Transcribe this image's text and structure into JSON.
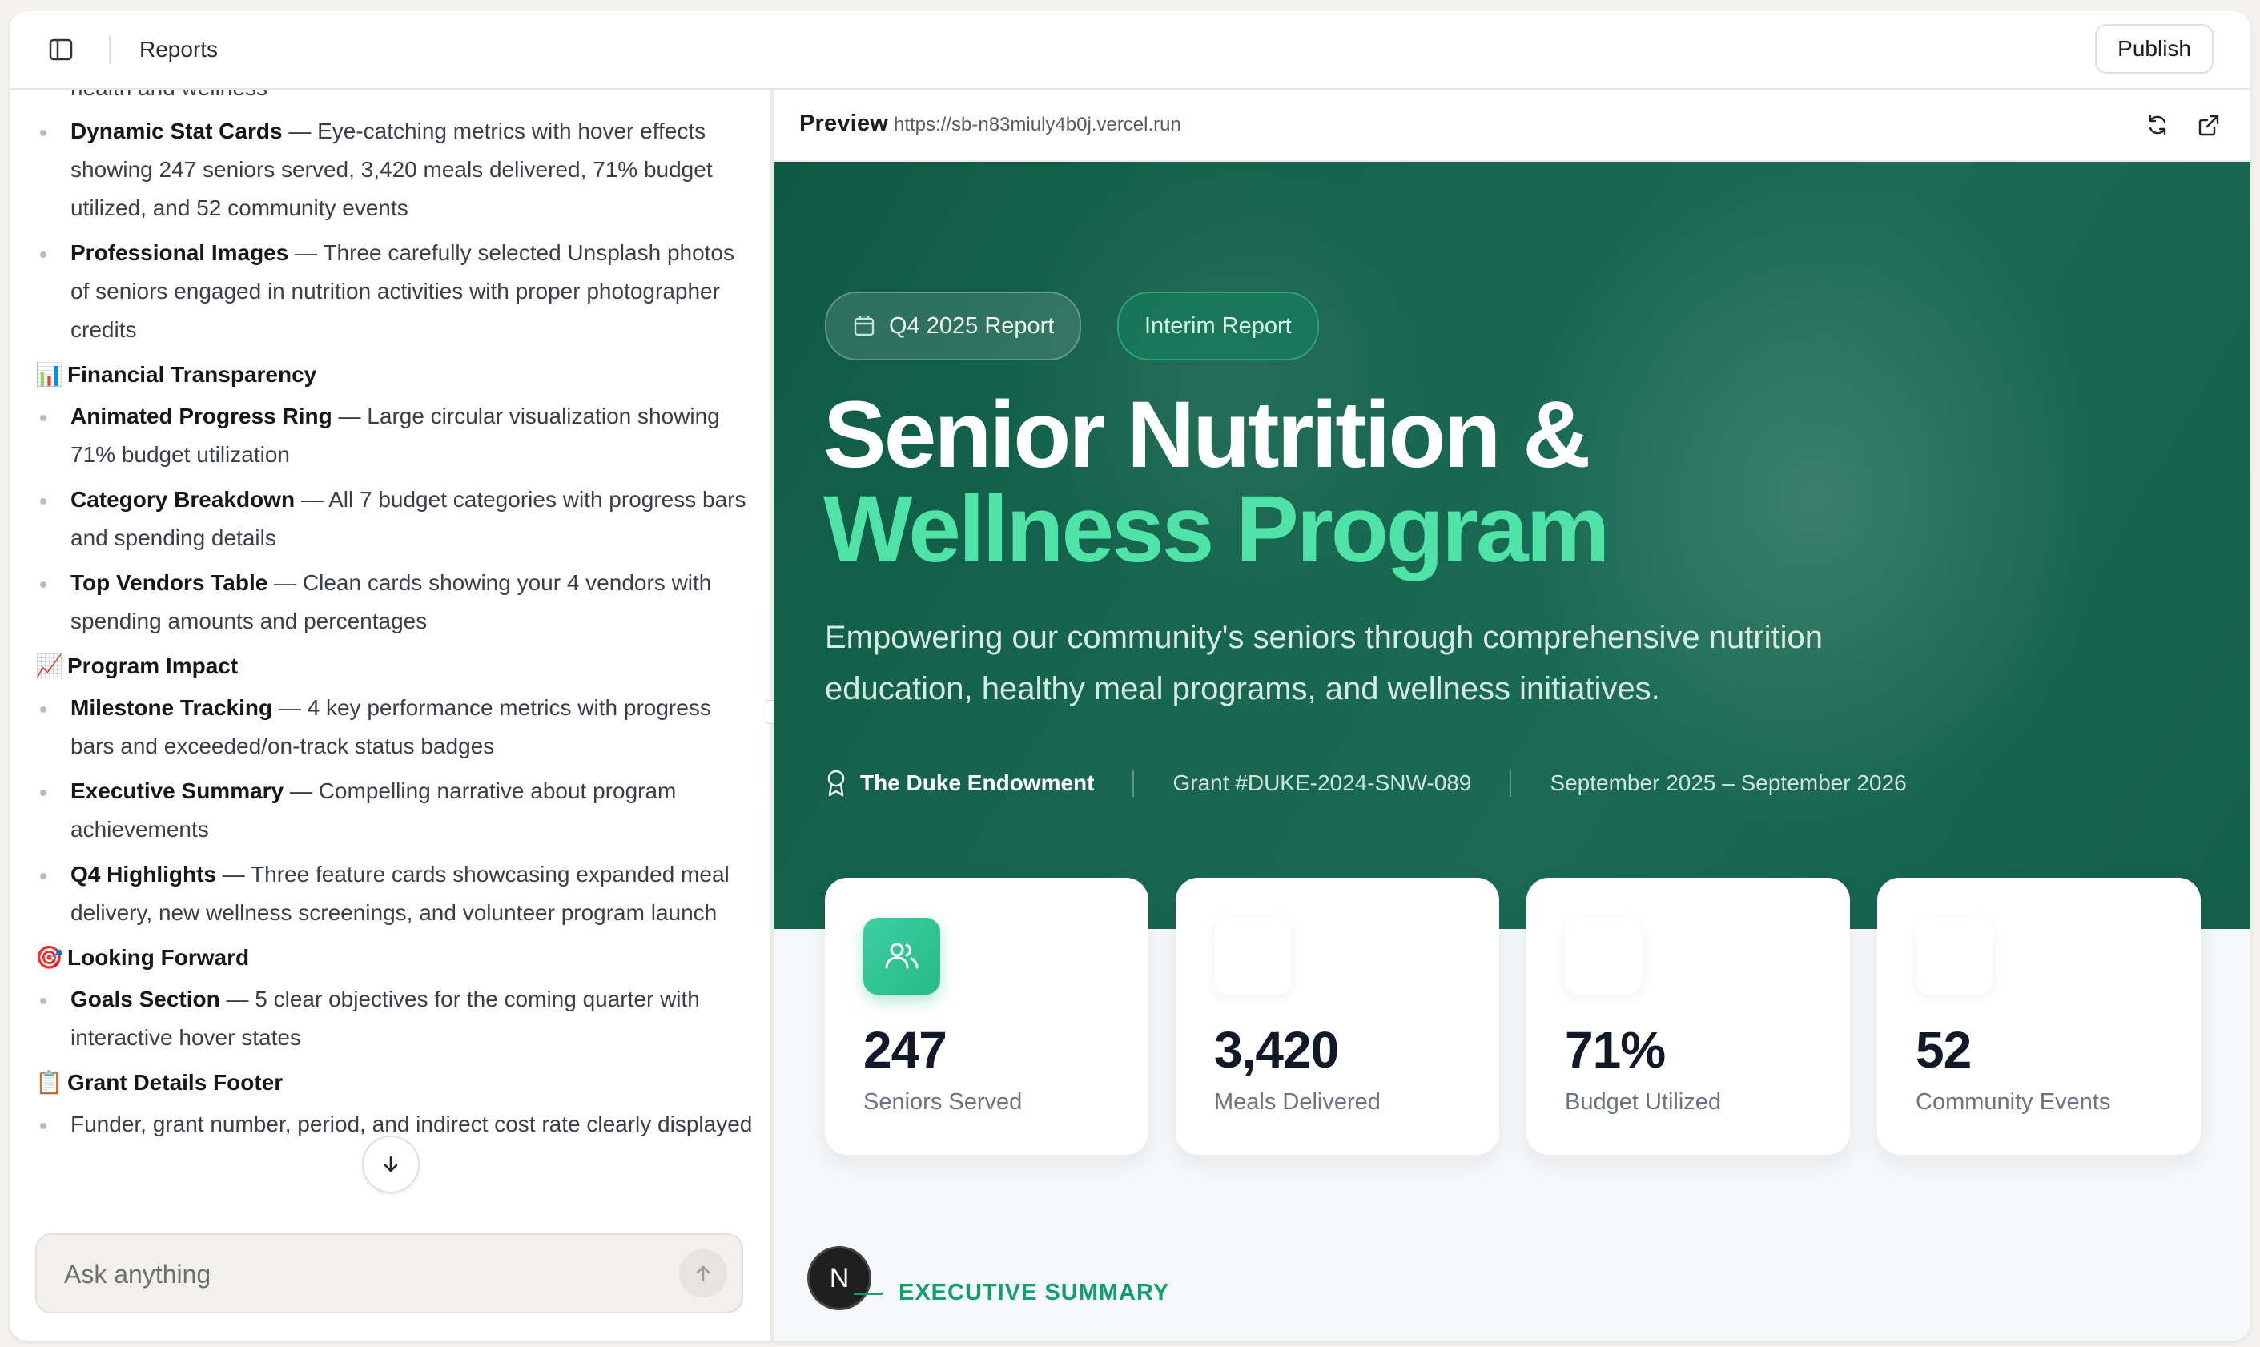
{
  "topbar": {
    "title": "Reports",
    "publish_label": "Publish"
  },
  "chat": {
    "intro_tail": "health and wellness",
    "groups": [
      {
        "heading": null,
        "items": [
          {
            "title": "Dynamic Stat Cards",
            "text": " — Eye-catching metrics with hover effects showing 247 seniors served, 3,420 meals delivered, 71% budget utilized, and 52 community events"
          },
          {
            "title": "Professional Images",
            "text": " — Three carefully selected Unsplash photos of seniors engaged in nutrition activities with proper photographer credits"
          }
        ]
      },
      {
        "emoji": "📊",
        "heading": "Financial Transparency",
        "items": [
          {
            "title": "Animated Progress Ring",
            "text": " — Large circular visualization showing 71% budget utilization"
          },
          {
            "title": "Category Breakdown",
            "text": " — All 7 budget categories with progress bars and spending details"
          },
          {
            "title": "Top Vendors Table",
            "text": " — Clean cards showing your 4 vendors with spending amounts and percentages"
          }
        ]
      },
      {
        "emoji": "📈",
        "heading": "Program Impact",
        "items": [
          {
            "title": "Milestone Tracking",
            "text": " — 4 key performance metrics with progress bars and exceeded/on-track status badges"
          },
          {
            "title": "Executive Summary",
            "text": " — Compelling narrative about program achievements"
          },
          {
            "title": "Q4 Highlights",
            "text": " — Three feature cards showcasing expanded meal delivery, new wellness screenings, and volunteer program launch"
          }
        ]
      },
      {
        "emoji": "🎯",
        "heading": "Looking Forward",
        "items": [
          {
            "title": "Goals Section",
            "text": " — 5 clear objectives for the coming quarter with interactive hover states"
          }
        ]
      },
      {
        "emoji": "📋",
        "heading": "Grant Details Footer",
        "items": [
          {
            "title": "",
            "text": "Funder, grant number, period, and indirect cost rate clearly displayed"
          }
        ]
      }
    ],
    "composer_placeholder": "Ask anything"
  },
  "preview": {
    "label": "Preview",
    "url": "https://sb-n83miuly4b0j.vercel.run",
    "hero": {
      "badge_quarter": "Q4 2025 Report",
      "badge_interim": "Interim Report",
      "title_line1": "Senior Nutrition &",
      "title_line2": "Wellness Program",
      "subtitle": "Empowering our community's seniors through comprehensive nutrition education, healthy meal programs, and wellness initiatives.",
      "funder": "The Duke Endowment",
      "grant": "Grant #DUKE-2024-SNW-089",
      "period": "September 2025 – September 2026"
    },
    "stats": [
      {
        "value": "247",
        "label": "Seniors Served"
      },
      {
        "value": "3,420",
        "label": "Meals Delivered"
      },
      {
        "value": "71%",
        "label": "Budget Utilized"
      },
      {
        "value": "52",
        "label": "Community Events"
      }
    ],
    "avatar_letter": "N",
    "section_label": "EXECUTIVE SUMMARY"
  },
  "colors": {
    "accent_green": "#4fe3a8",
    "hero_bg": "#17664f",
    "section_green": "#10a070"
  }
}
